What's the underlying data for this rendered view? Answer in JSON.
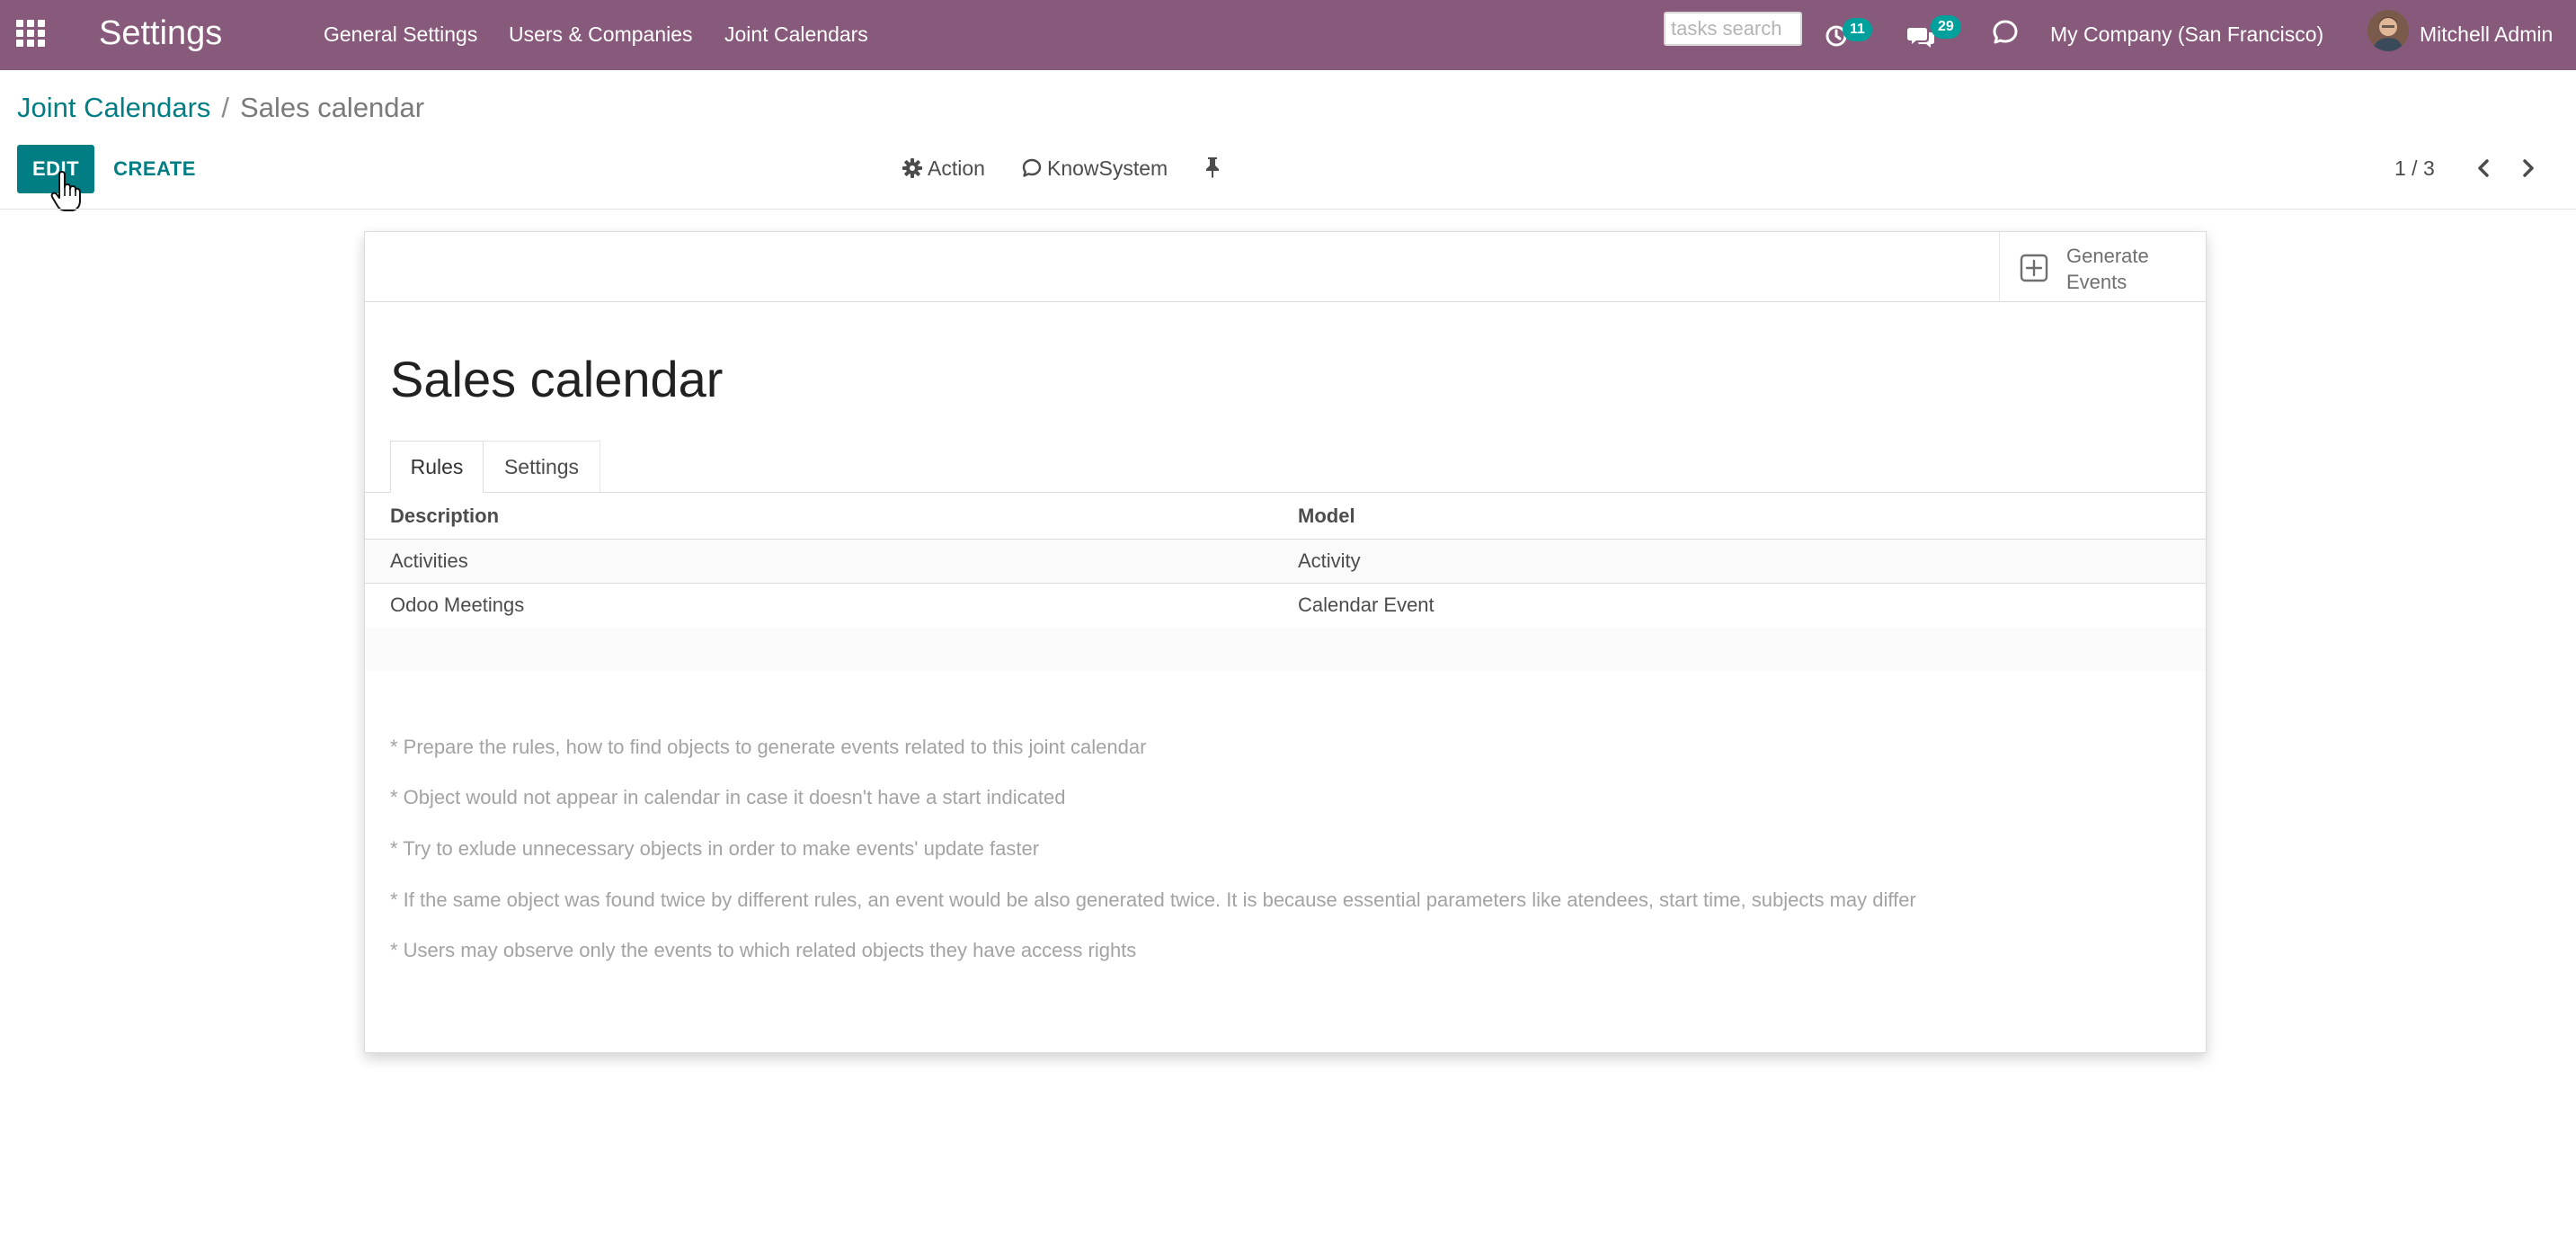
{
  "navbar": {
    "app_title": "Settings",
    "menu": [
      "General Settings",
      "Users & Companies",
      "Joint Calendars"
    ],
    "search_placeholder": "tasks search",
    "activity_count": "11",
    "message_count": "29",
    "company": "My Company (San Francisco)",
    "user": "Mitchell Admin",
    "color": "#875a7b"
  },
  "breadcrumb": {
    "parent": "Joint Calendars",
    "separator": "/",
    "current": "Sales calendar"
  },
  "control_panel": {
    "edit_label": "EDIT",
    "create_label": "CREATE",
    "action_label": "Action",
    "knowsystem_label": "KnowSystem",
    "pager": "1 / 3",
    "accent_color": "#017e84"
  },
  "form": {
    "generate_button": "Generate Events",
    "title": "Sales calendar",
    "tabs": [
      "Rules",
      "Settings"
    ],
    "columns": [
      "Description",
      "Model"
    ],
    "rows": [
      {
        "description": "Activities",
        "model": "Activity"
      },
      {
        "description": "Odoo Meetings",
        "model": "Calendar Event"
      }
    ],
    "notes": [
      "* Prepare the rules, how to find objects to generate events related to this joint calendar",
      "* Object would not appear in calendar in case it doesn't have a start indicated",
      "* Try to exlude unnecessary objects in order to make events' update faster",
      "* If the same object was found twice by different rules, an event would be also generated twice. It is because essential parameters like atendees, start time, subjects may differ",
      "* Users may observe only the events to which related objects they have access rights"
    ]
  }
}
